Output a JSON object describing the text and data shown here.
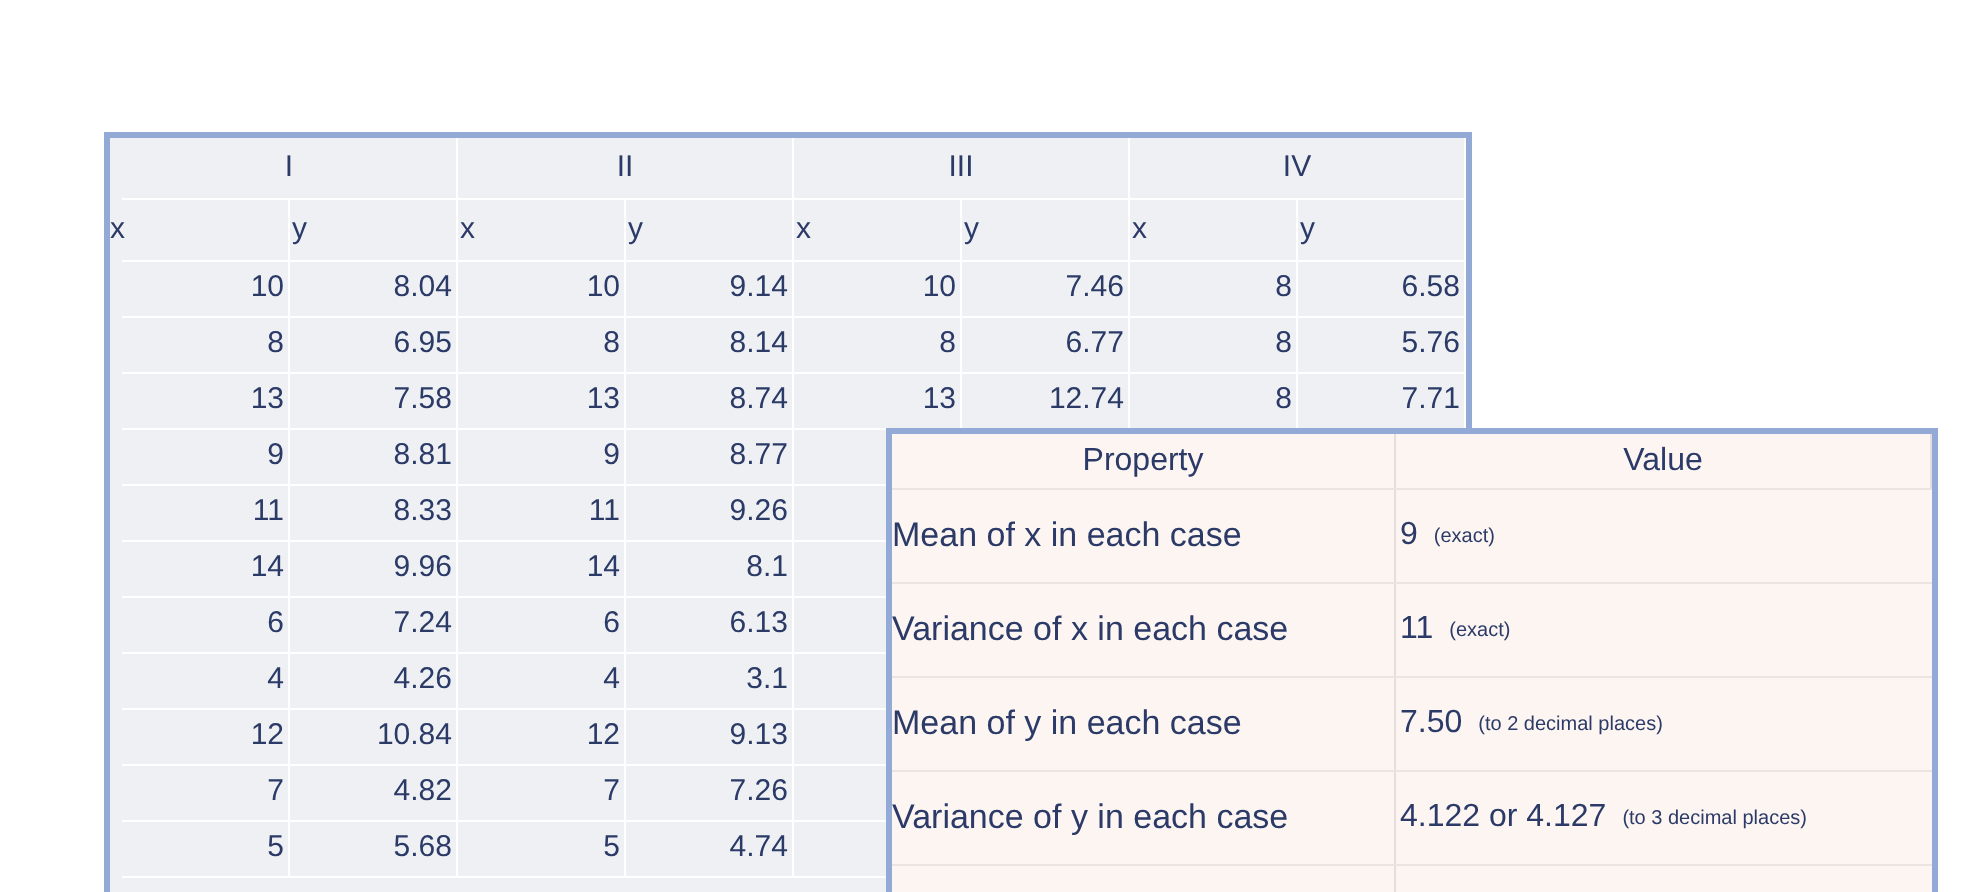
{
  "data_table": {
    "groups": [
      "I",
      "II",
      "III",
      "IV"
    ],
    "column_labels": [
      "x",
      "y",
      "x",
      "y",
      "x",
      "y",
      "x",
      "y"
    ],
    "rows": [
      {
        "cells": [
          "10",
          "8.04",
          "10",
          "9.14",
          "10",
          "7.46",
          "8",
          "6.58"
        ]
      },
      {
        "cells": [
          "8",
          "6.95",
          "8",
          "8.14",
          "8",
          "6.77",
          "8",
          "5.76"
        ]
      },
      {
        "cells": [
          "13",
          "7.58",
          "13",
          "8.74",
          "13",
          "12.74",
          "8",
          "7.71"
        ]
      },
      {
        "cells": [
          "9",
          "8.81",
          "9",
          "8.77"
        ]
      },
      {
        "cells": [
          "11",
          "8.33",
          "11",
          "9.26"
        ]
      },
      {
        "cells": [
          "14",
          "9.96",
          "14",
          "8.1"
        ]
      },
      {
        "cells": [
          "6",
          "7.24",
          "6",
          "6.13"
        ]
      },
      {
        "cells": [
          "4",
          "4.26",
          "4",
          "3.1"
        ]
      },
      {
        "cells": [
          "12",
          "10.84",
          "12",
          "9.13"
        ]
      },
      {
        "cells": [
          "7",
          "4.82",
          "7",
          "7.26"
        ]
      },
      {
        "cells": [
          "5",
          "5.68",
          "5",
          "4.74"
        ]
      }
    ]
  },
  "property_table": {
    "columns": [
      "Property",
      "Value"
    ],
    "rows": [
      {
        "property": "Mean of x in each case",
        "value": "9",
        "note": "(exact)"
      },
      {
        "property": "Variance of x in each case",
        "value": "11",
        "note": "(exact)"
      },
      {
        "property": "Mean of y in each case",
        "value": "7.50",
        "note": "(to 2 decimal places)"
      },
      {
        "property": "Variance of y in each case",
        "value": "4.122 or 4.127",
        "note": "(to 3 decimal places)"
      }
    ]
  }
}
